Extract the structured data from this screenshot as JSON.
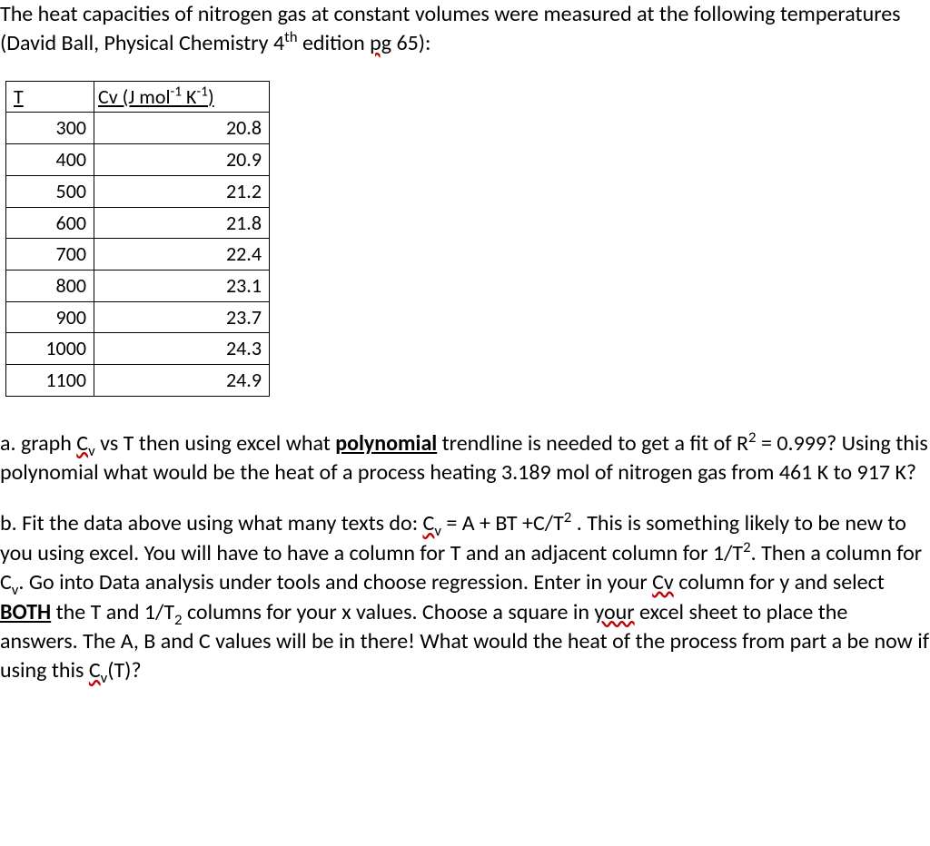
{
  "intro": {
    "part1": "The heat capacities of nitrogen gas at constant volumes were measured at the following temperatures (David Ball, Physical Chemistry 4",
    "sup1": "th",
    "part2": " edition ",
    "pg": "pg",
    "part3": " 65):"
  },
  "table": {
    "header_t": "T",
    "header_cv_pre": "Cv (J mol",
    "header_cv_sup1": "-1",
    "header_cv_mid": " K",
    "header_cv_sup2": "-1",
    "header_cv_post": ")",
    "rows": [
      {
        "t": "300",
        "cv": "20.8"
      },
      {
        "t": "400",
        "cv": "20.9"
      },
      {
        "t": "500",
        "cv": "21.2"
      },
      {
        "t": "600",
        "cv": "21.8"
      },
      {
        "t": "700",
        "cv": "22.4"
      },
      {
        "t": "800",
        "cv": "23.1"
      },
      {
        "t": "900",
        "cv": "23.7"
      },
      {
        "t": "1000",
        "cv": "24.3"
      },
      {
        "t": "1100",
        "cv": "24.9"
      }
    ]
  },
  "part_a": {
    "t1": "a. graph ",
    "cv": "C",
    "cv_sub": "v",
    "t2": " vs T then using excel what ",
    "poly": "polynomial",
    "t3": " trendline is needed to get a fit of R",
    "sup2": "2",
    "t4": " = 0.999?  Using this polynomial what would be the heat of a process heating 3.189 mol of nitrogen gas from 461 K to 917 K?"
  },
  "part_b": {
    "t1": "b. Fit the data above using what many texts do: ",
    "cv1": "C",
    "cv1_sub": "v",
    "t2": " = A + BT +C/T",
    "sup_sq1": "2",
    "t3": " .  This is something likely to be new to you using excel.  You will have to have a column for T and an adjacent column for 1/T",
    "sup_sq2": "2",
    "t4": ".  Then a column for C",
    "sub_v1": "v",
    "t5": ".  Go into Data analysis under tools and choose regression.  Enter in your ",
    "cv2": "Cv",
    "t6": " column for y and select ",
    "both": "BOTH",
    "t7": " the T and 1/T",
    "sub_2": "2",
    "t8": " columns for your x values.  Choose a square in ",
    "your": "your",
    "t9": " excel sheet to place the answers.  The A, B and C values will be in there!  What would the heat of the process from part a be now if using this ",
    "cv3": "C",
    "cv3_sub": "v",
    "t10": "(T)?"
  },
  "chart_data": {
    "type": "table",
    "columns": [
      "T",
      "Cv (J mol-1 K-1)"
    ],
    "rows": [
      [
        300,
        20.8
      ],
      [
        400,
        20.9
      ],
      [
        500,
        21.2
      ],
      [
        600,
        21.8
      ],
      [
        700,
        22.4
      ],
      [
        800,
        23.1
      ],
      [
        900,
        23.7
      ],
      [
        1000,
        24.3
      ],
      [
        1100,
        24.9
      ]
    ]
  }
}
